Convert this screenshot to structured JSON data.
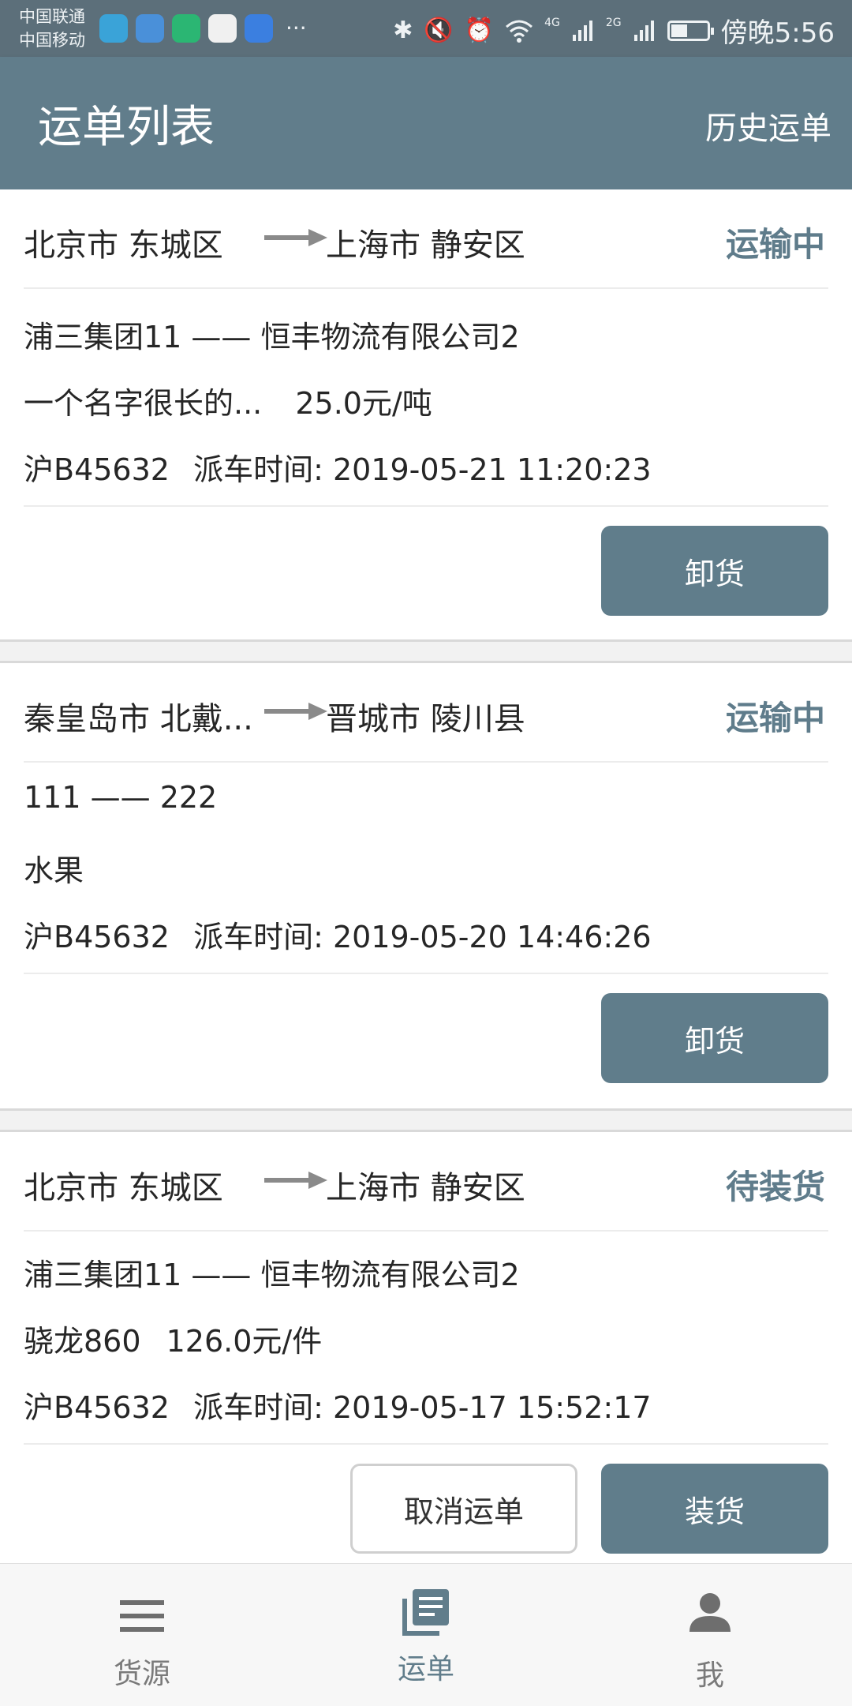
{
  "status_bar": {
    "carrier1": "中国联通",
    "carrier2": "中国移动",
    "network_4g": "4G",
    "network_2g": "2G",
    "battery_level": 0.45,
    "time": "傍晚5:56",
    "more": "···"
  },
  "header": {
    "title": "运单列表",
    "action": "历史运单"
  },
  "orders": [
    {
      "origin": "北京市 东城区",
      "destination": "上海市 静安区",
      "status": "运输中",
      "parties": "浦三集团11 —— 恒丰物流有限公司2",
      "goods": "一个名字很长的...",
      "price": "25.0元/吨",
      "plate": "沪B45632",
      "dispatch_label": "派车时间:",
      "dispatch_time": "2019-05-21 11:20:23",
      "primary_button": "卸货"
    },
    {
      "origin": "秦皇岛市 北戴...",
      "destination": "晋城市 陵川县",
      "status": "运输中",
      "parties": "111 —— 222",
      "goods": "水果",
      "price": "",
      "plate": "沪B45632",
      "dispatch_label": "派车时间:",
      "dispatch_time": "2019-05-20 14:46:26",
      "primary_button": "卸货"
    },
    {
      "origin": "北京市 东城区",
      "destination": "上海市 静安区",
      "status": "待装货",
      "parties": "浦三集团11 —— 恒丰物流有限公司2",
      "goods": "骁龙860",
      "price": "126.0元/件",
      "plate": "沪B45632",
      "dispatch_label": "派车时间:",
      "dispatch_time": "2019-05-17 15:52:17",
      "secondary_button": "取消运单",
      "primary_button": "装货"
    }
  ],
  "bottom_nav": {
    "items": [
      {
        "label": "货源",
        "icon": "menu-lines-icon"
      },
      {
        "label": "运单",
        "icon": "document-stack-icon",
        "active": true
      },
      {
        "label": "我",
        "icon": "person-icon"
      }
    ]
  },
  "colors": {
    "header": "#617d8b",
    "statusbar": "#5c6f7a",
    "accent": "#607d8b"
  }
}
